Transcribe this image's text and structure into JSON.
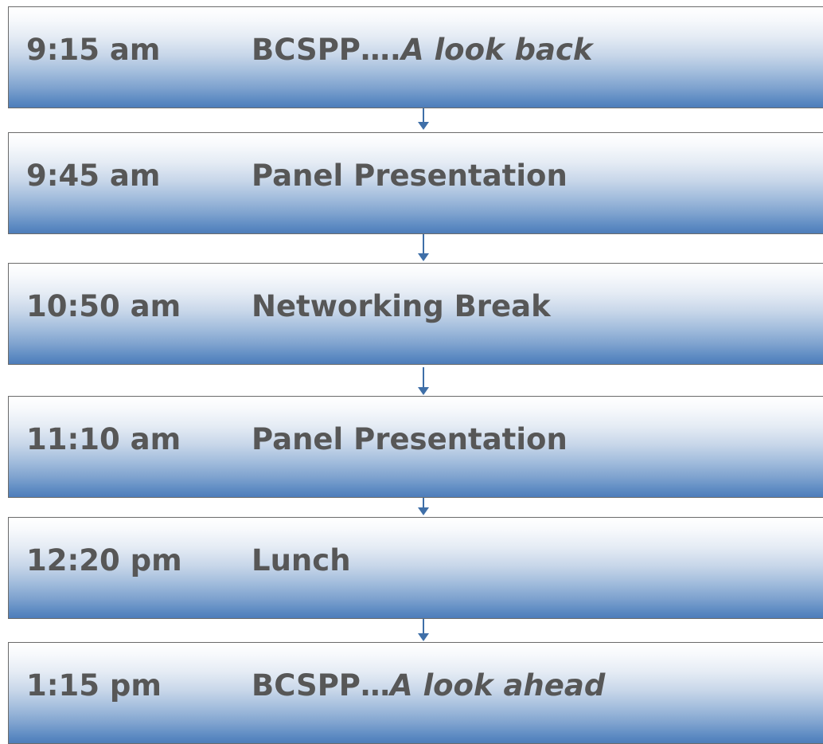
{
  "agenda": {
    "items": [
      {
        "time": "9:15 am",
        "title": "BCSPP….",
        "title_italic": "A look back"
      },
      {
        "time": "9:45 am",
        "title": "Panel Presentation",
        "title_italic": ""
      },
      {
        "time": "10:50 am",
        "title": "Networking Break",
        "title_italic": ""
      },
      {
        "time": "11:10 am",
        "title": "Panel Presentation",
        "title_italic": ""
      },
      {
        "time": "12:20 pm",
        "title": "Lunch",
        "title_italic": ""
      },
      {
        "time": "1:15 pm",
        "title": "BCSPP…",
        "title_italic": "A look ahead"
      }
    ]
  },
  "colors": {
    "text": "#575757",
    "connector": "#3f6fa8",
    "gradient_bottom": "#4d7dba",
    "border": "#6b6b6b"
  }
}
